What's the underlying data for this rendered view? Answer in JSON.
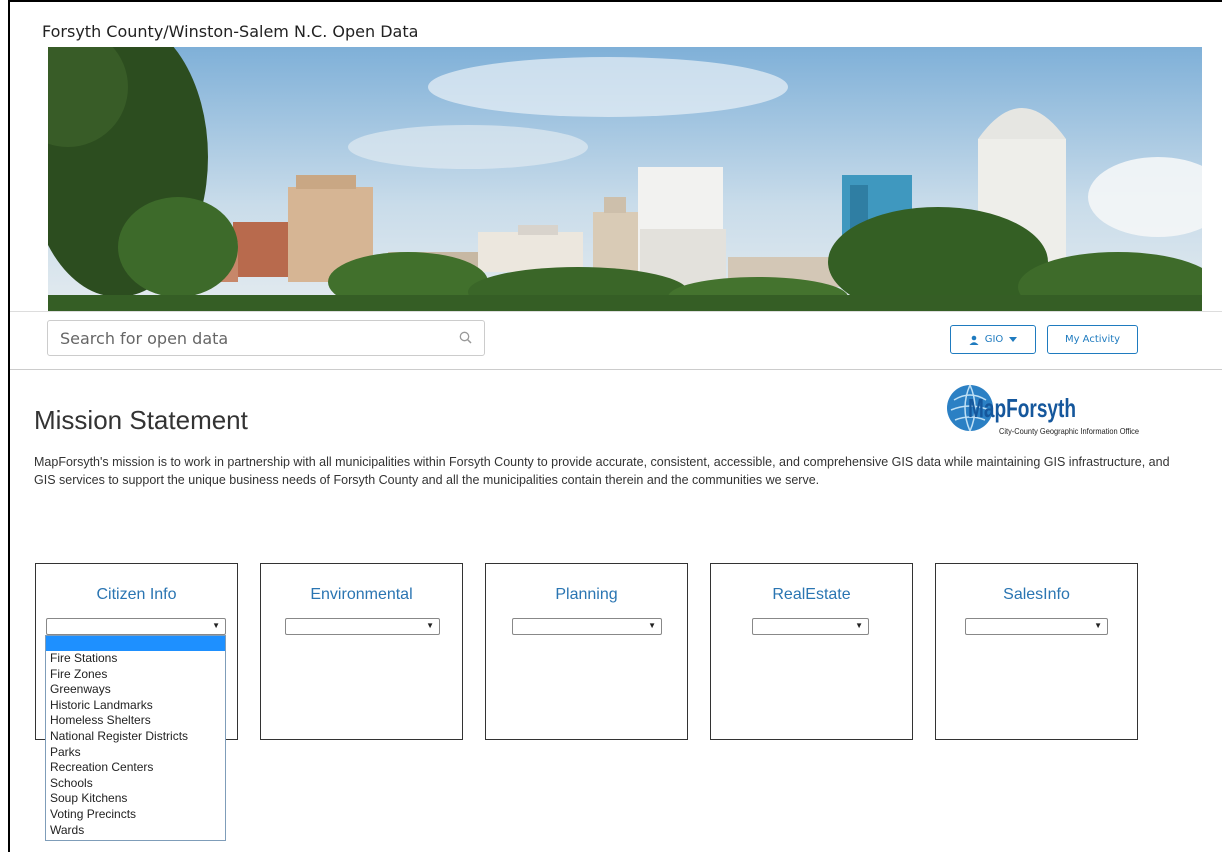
{
  "header": {
    "site_title": "Forsyth County/Winston-Salem N.C. Open Data"
  },
  "toolbar": {
    "search_placeholder": "Search for open data",
    "user_button_label": "GIO",
    "activity_button_label": "My Activity"
  },
  "mission": {
    "title": "Mission Statement",
    "text": "MapForsyth's mission is to work in partnership with all municipalities within Forsyth County to provide accurate, consistent, accessible, and comprehensive GIS data while maintaining GIS infrastructure, and GIS services to support the unique business needs of Forsyth County and all the municipalities contain therein and the communities we serve."
  },
  "logo": {
    "name": "MapForsyth",
    "tagline": "City-County Geographic Information Office"
  },
  "categories": [
    {
      "title": "Citizen Info",
      "selected": ""
    },
    {
      "title": "Environmental",
      "selected": ""
    },
    {
      "title": "Planning",
      "selected": ""
    },
    {
      "title": "RealEstate",
      "selected": ""
    },
    {
      "title": "SalesInfo",
      "selected": ""
    }
  ],
  "citizen_dropdown": {
    "options": [
      "Fire Stations",
      "Fire Zones",
      "Greenways",
      "Historic Landmarks",
      "Homeless Shelters",
      "National Register Districts",
      "Parks",
      "Recreation Centers",
      "Schools",
      "Soup Kitchens",
      "Voting Precincts",
      "Wards"
    ]
  },
  "colors": {
    "accent": "#1f7bbf",
    "card_title": "#2a75b2",
    "dropdown_highlight": "#1e90ff"
  }
}
